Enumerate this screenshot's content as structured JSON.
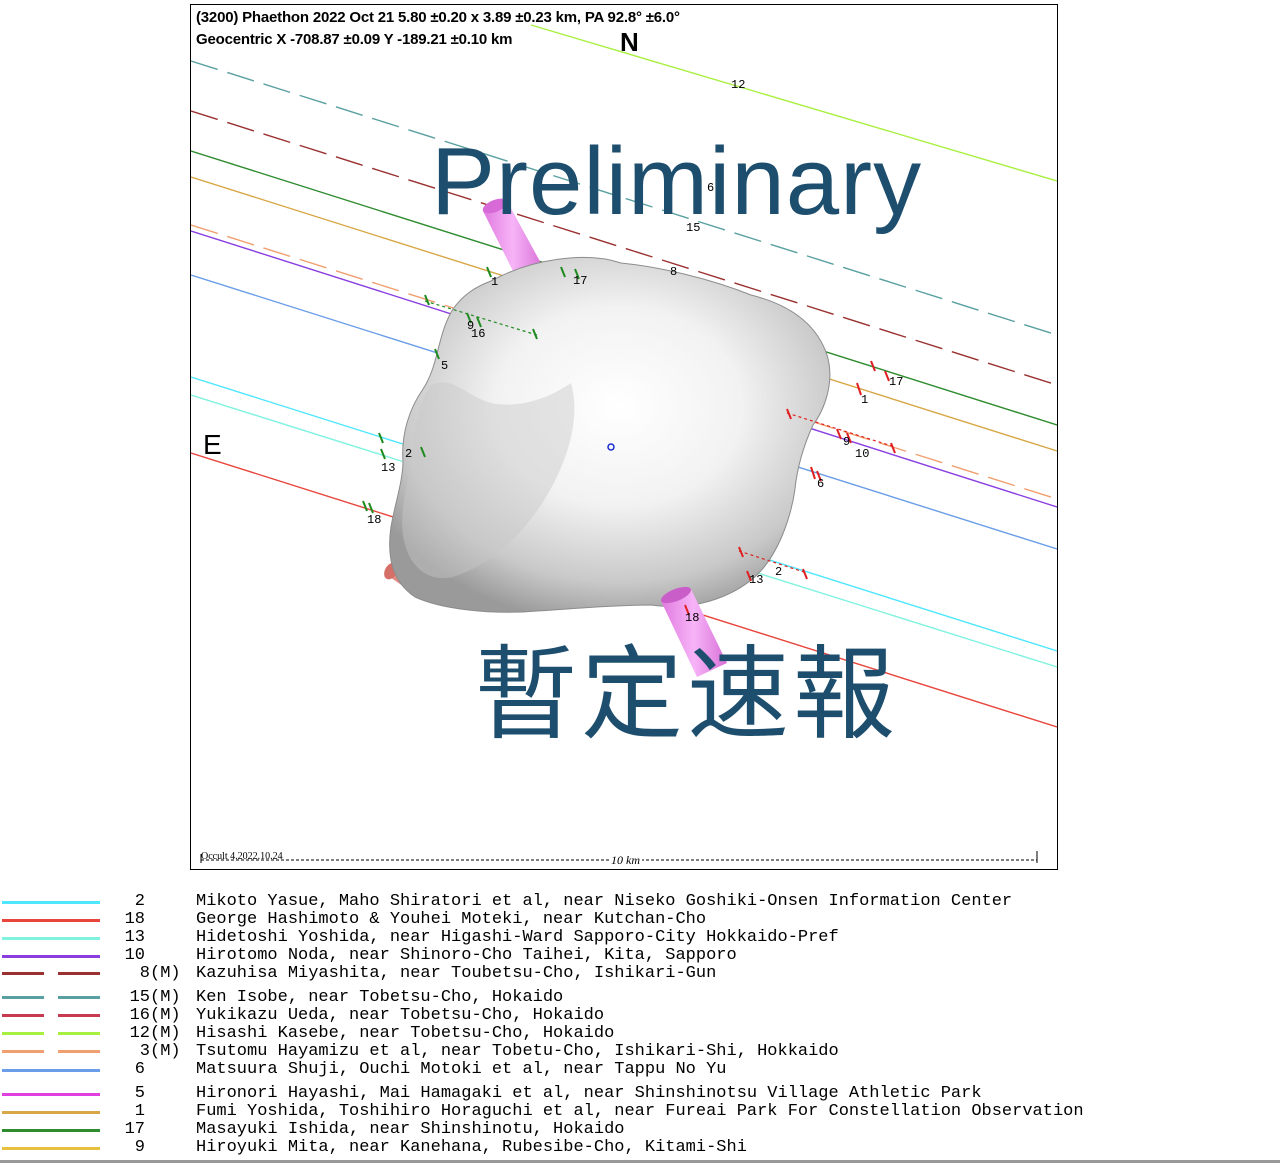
{
  "plot": {
    "header_line1": "(3200) Phaethon  2022 Oct 21   5.80 ±0.20 x 3.89 ±0.23 km,  PA 92.8° ±6.0°",
    "header_line2": "Geocentric  X  -708.87 ±0.09  Y -189.21 ±0.10 km",
    "north_label": "N",
    "east_label": "E",
    "watermark_en": "Preliminary",
    "watermark_ja": "暫定速報",
    "credit": "Occult 4.2022.10.24",
    "scale_label": "10 km",
    "chord_labels": [
      {
        "text": "12"
      },
      {
        "text": "6"
      },
      {
        "text": "15"
      },
      {
        "text": "8"
      },
      {
        "text": "1"
      },
      {
        "text": "17"
      },
      {
        "text": "9"
      },
      {
        "text": "16"
      },
      {
        "text": "5"
      },
      {
        "text": "2"
      },
      {
        "text": "13"
      },
      {
        "text": "18"
      },
      {
        "text": "17"
      },
      {
        "text": "1"
      },
      {
        "text": "9"
      },
      {
        "text": "10"
      },
      {
        "text": "6"
      },
      {
        "text": "2"
      },
      {
        "text": "13"
      },
      {
        "text": "18"
      }
    ]
  },
  "legend": [
    {
      "num": "2",
      "flag": "",
      "observer": "Mikoto Yasue, Maho Shiratori et al, near Niseko Goshiki-Onsen Information Center",
      "color": "#4fe6ff",
      "style": "solid"
    },
    {
      "num": "18",
      "flag": "",
      "observer": "George Hashimoto & Youhei Moteki, near Kutchan-Cho",
      "color": "#e8453c",
      "style": "solid"
    },
    {
      "num": "13",
      "flag": "",
      "observer": "Hidetoshi Yoshida, near Higashi-Ward Sapporo-City Hokkaido-Pref",
      "color": "#7ff2e0",
      "style": "solid"
    },
    {
      "num": "10",
      "flag": "",
      "observer": "Hirotomo Noda, near Shinoro-Cho Taihei, Kita, Sapporo",
      "color": "#8a3ee0",
      "style": "solid"
    },
    {
      "num": "8",
      "flag": "(M)",
      "observer": "Kazuhisa Miyashita, near Toubetsu-Cho, Ishikari-Gun",
      "color": "#9a3030",
      "style": "dashed"
    },
    {
      "num": "15",
      "flag": "(M)",
      "observer": "Ken Isobe, near Tobetsu-Cho, Hokaido",
      "color": "#5aa0a0",
      "style": "dashed"
    },
    {
      "num": "16",
      "flag": "(M)",
      "observer": "Yukikazu Ueda, near Tobetsu-Cho, Hokaido",
      "color": "#c83a50",
      "style": "dashed"
    },
    {
      "num": "12",
      "flag": "(M)",
      "observer": "Hisashi Kasebe, near Tobetsu-Cho, Hokaido",
      "color": "#a8f040",
      "style": "dashed"
    },
    {
      "num": "3",
      "flag": "(M)",
      "observer": "Tsutomu Hayamizu et al, near Tobetu-Cho, Ishikari-Shi, Hokkaido",
      "color": "#f0a070",
      "style": "dashed"
    },
    {
      "num": "6",
      "flag": "",
      "observer": "Matsuura Shuji, Ouchi Motoki et al, near Tappu No Yu",
      "color": "#6b9ee8",
      "style": "solid"
    },
    {
      "num": "5",
      "flag": "",
      "observer": "Hironori Hayashi, Mai Hamagaki et al, near Shinshinotsu Village Athletic Park",
      "color": "#e040e0",
      "style": "solid"
    },
    {
      "num": "1",
      "flag": "",
      "observer": "Fumi Yoshida, Toshihiro Horaguchi et al, near Fureai Park For Constellation Observation",
      "color": "#d8a848",
      "style": "solid"
    },
    {
      "num": "17",
      "flag": "",
      "observer": "Masayuki Ishida, near Shinshinotu, Hokaido",
      "color": "#2e8b2e",
      "style": "solid"
    },
    {
      "num": "9",
      "flag": "",
      "observer": "Hiroyuki Mita, near Kanehana, Rubesibe-Cho, Kitami-Shi",
      "color": "#e8c040",
      "style": "solid"
    }
  ]
}
